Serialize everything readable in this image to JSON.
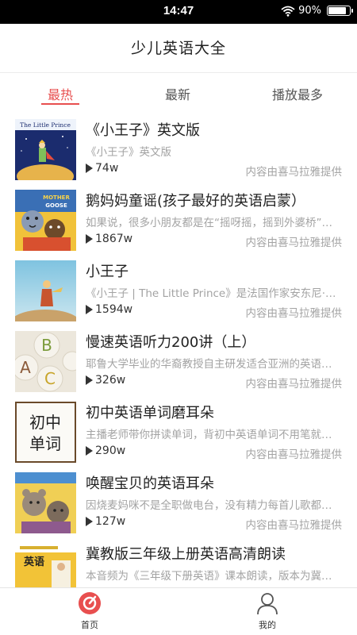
{
  "status_bar": {
    "time": "14:47",
    "battery": "90%",
    "battery_level": 0.9
  },
  "header": {
    "title": "少儿英语大全"
  },
  "tabs": [
    {
      "label": "最热",
      "active": true
    },
    {
      "label": "最新",
      "active": false
    },
    {
      "label": "播放最多",
      "active": false
    }
  ],
  "albums": [
    {
      "title": "《小王子》英文版",
      "desc": "《小王子》英文版",
      "plays": "74w",
      "source": "内容由喜马拉雅提供",
      "cover": "little-prince-book-cover"
    },
    {
      "title": "鹅妈妈童谣(孩子最好的英语启蒙）",
      "desc": "如果说，很多小朋友都是在“摇呀摇，摇到外婆桥”中成长的",
      "plays": "1867w",
      "source": "内容由喜马拉雅提供",
      "cover": "mother-goose-cover"
    },
    {
      "title": "小王子",
      "desc": "《小王子 | The Little Prince》是法国作家安东尼·德·圣埃克苏佩里",
      "plays": "1594w",
      "source": "内容由喜马拉雅提供",
      "cover": "little-prince-illustration"
    },
    {
      "title": "慢速英语听力200讲（上）",
      "desc": "耶鲁大学毕业的华裔教授自主研发适合亚洲的英语学习方法",
      "plays": "326w",
      "source": "内容由喜马拉雅提供",
      "cover": "abc-letters-cover"
    },
    {
      "title": "初中英语单词磨耳朵",
      "desc": "主播老师带你拼读单词，背初中英语单词不用笔就能记住",
      "plays": "290w",
      "source": "内容由喜马拉雅提供",
      "cover": "junior-vocabulary-cover",
      "cover_text": [
        "初中",
        "单词"
      ]
    },
    {
      "title": "唤醒宝贝的英语耳朵",
      "desc": "因烧麦妈咪不是全职做电台，没有精力每首儿歌都配上中文",
      "plays": "127w",
      "source": "内容由喜马拉雅提供",
      "cover": "cartoon-bears-cover"
    },
    {
      "title": "冀教版三年级上册英语高清朗读",
      "desc": "本音频为《三年级下册英语》课本朗读，版本为冀教版",
      "plays": "",
      "source": "",
      "cover": "textbook-cover",
      "cover_text": [
        "英语"
      ]
    }
  ],
  "bottom_nav": [
    {
      "label": "首页",
      "icon": "home-disc-icon",
      "active": true
    },
    {
      "label": "我的",
      "icon": "profile-icon",
      "active": false
    }
  ],
  "colors": {
    "accent": "#e84f4f",
    "muted": "#a3a3a3",
    "text": "#222222"
  }
}
